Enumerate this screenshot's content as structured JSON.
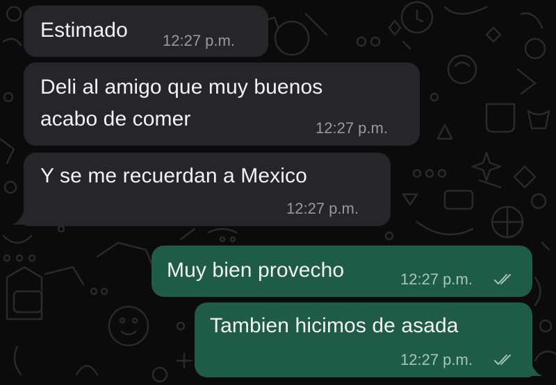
{
  "chat": {
    "messages": [
      {
        "direction": "incoming",
        "text_lines": [
          "Estimado"
        ],
        "time": "12:27 p.m.",
        "read": false
      },
      {
        "direction": "incoming",
        "text_lines": [
          "Deli al amigo que muy buenos",
          "acabo de comer"
        ],
        "time": "12:27 p.m.",
        "read": false
      },
      {
        "direction": "incoming",
        "text_lines": [
          "Y se me recuerdan a Mexico"
        ],
        "time": "12:27 p.m.",
        "read": false
      },
      {
        "direction": "outgoing",
        "text_lines": [
          "Muy bien provecho"
        ],
        "time": "12:27 p.m.",
        "read": true,
        "status_icon": "double-check-icon"
      },
      {
        "direction": "outgoing",
        "text_lines": [
          "Tambien hicimos de asada"
        ],
        "time": "12:27 p.m.",
        "read": true,
        "status_icon": "double-check-icon"
      }
    ]
  },
  "colors": {
    "background": "#0b0b0b",
    "incoming_bubble": "#262628",
    "outgoing_bubble": "#1f5c48",
    "text": "#f3f3f3",
    "timestamp_incoming": "#9a9a9d",
    "timestamp_outgoing": "#a6c7b9"
  }
}
